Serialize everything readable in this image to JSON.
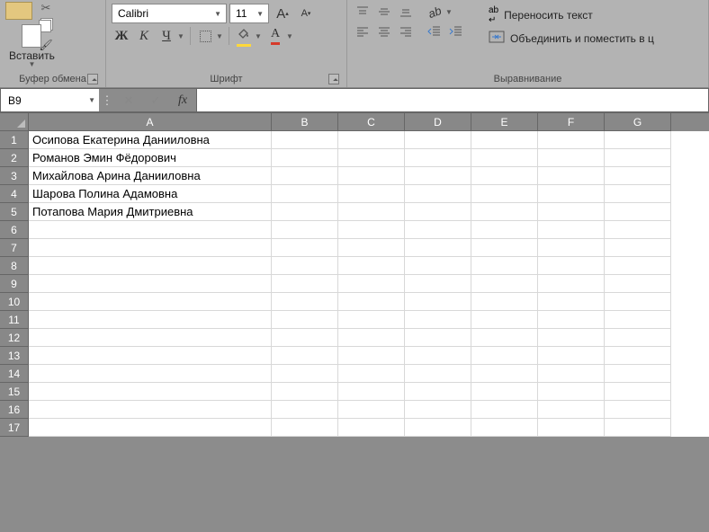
{
  "ribbon": {
    "clipboard": {
      "label": "Буфер обмена",
      "paste": "Вставить"
    },
    "font": {
      "label": "Шрифт",
      "name": "Calibri",
      "size": "11",
      "bold": "Ж",
      "italic": "К",
      "underline": "Ч",
      "bigA": "А",
      "smallA": "А",
      "letterA": "А"
    },
    "align": {
      "label": "Выравнивание",
      "wrap": "Переносить текст",
      "merge": "Объединить и поместить в ц"
    }
  },
  "namebox": "B9",
  "fx_label": "fx",
  "columns": [
    "A",
    "B",
    "C",
    "D",
    "E",
    "F",
    "G"
  ],
  "rows": [
    {
      "n": "1",
      "a": "Осипова Екатерина Данииловна"
    },
    {
      "n": "2",
      "a": "Романов Эмин Фёдорович"
    },
    {
      "n": "3",
      "a": "Михайлова Арина Данииловна"
    },
    {
      "n": "4",
      "a": "Шарова Полина Адамовна"
    },
    {
      "n": "5",
      "a": "Потапова Мария Дмитриевна"
    },
    {
      "n": "6",
      "a": ""
    },
    {
      "n": "7",
      "a": ""
    },
    {
      "n": "8",
      "a": ""
    },
    {
      "n": "9",
      "a": ""
    },
    {
      "n": "10",
      "a": ""
    },
    {
      "n": "11",
      "a": ""
    },
    {
      "n": "12",
      "a": ""
    },
    {
      "n": "13",
      "a": ""
    },
    {
      "n": "14",
      "a": ""
    },
    {
      "n": "15",
      "a": ""
    },
    {
      "n": "16",
      "a": ""
    },
    {
      "n": "17",
      "a": ""
    }
  ]
}
